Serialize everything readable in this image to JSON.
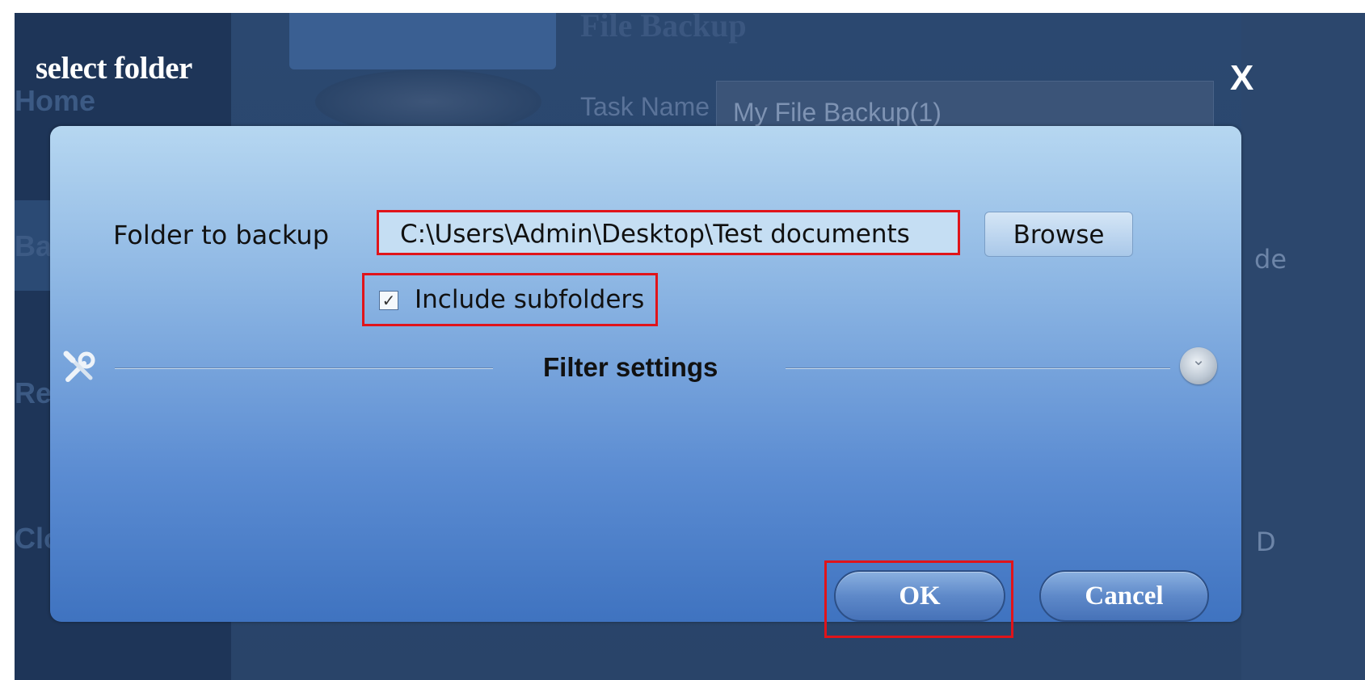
{
  "background": {
    "sidebar_items": [
      "Home",
      "Ba",
      "Re",
      "Clo"
    ],
    "title": "File Backup",
    "task_name_label": "Task Name",
    "task_name_value": "My File Backup(1)",
    "right_fragments": [
      "de",
      "D"
    ]
  },
  "dialog": {
    "title": "select folder",
    "close_label": "X",
    "folder_label": "Folder to backup",
    "folder_path": "C:\\Users\\Admin\\Desktop\\Test documents",
    "browse_label": "Browse",
    "include_subfolders_label": "Include subfolders",
    "include_subfolders_checked": true,
    "checkbox_mark": "✓",
    "filter_title": "Filter settings",
    "filter_icon": "tools-icon",
    "expand_glyph": "⌄",
    "ok_label": "OK",
    "cancel_label": "Cancel"
  },
  "colors": {
    "highlight": "#e0141a",
    "panel_top": "#b6d7f1",
    "panel_bottom": "#3f73c0"
  }
}
